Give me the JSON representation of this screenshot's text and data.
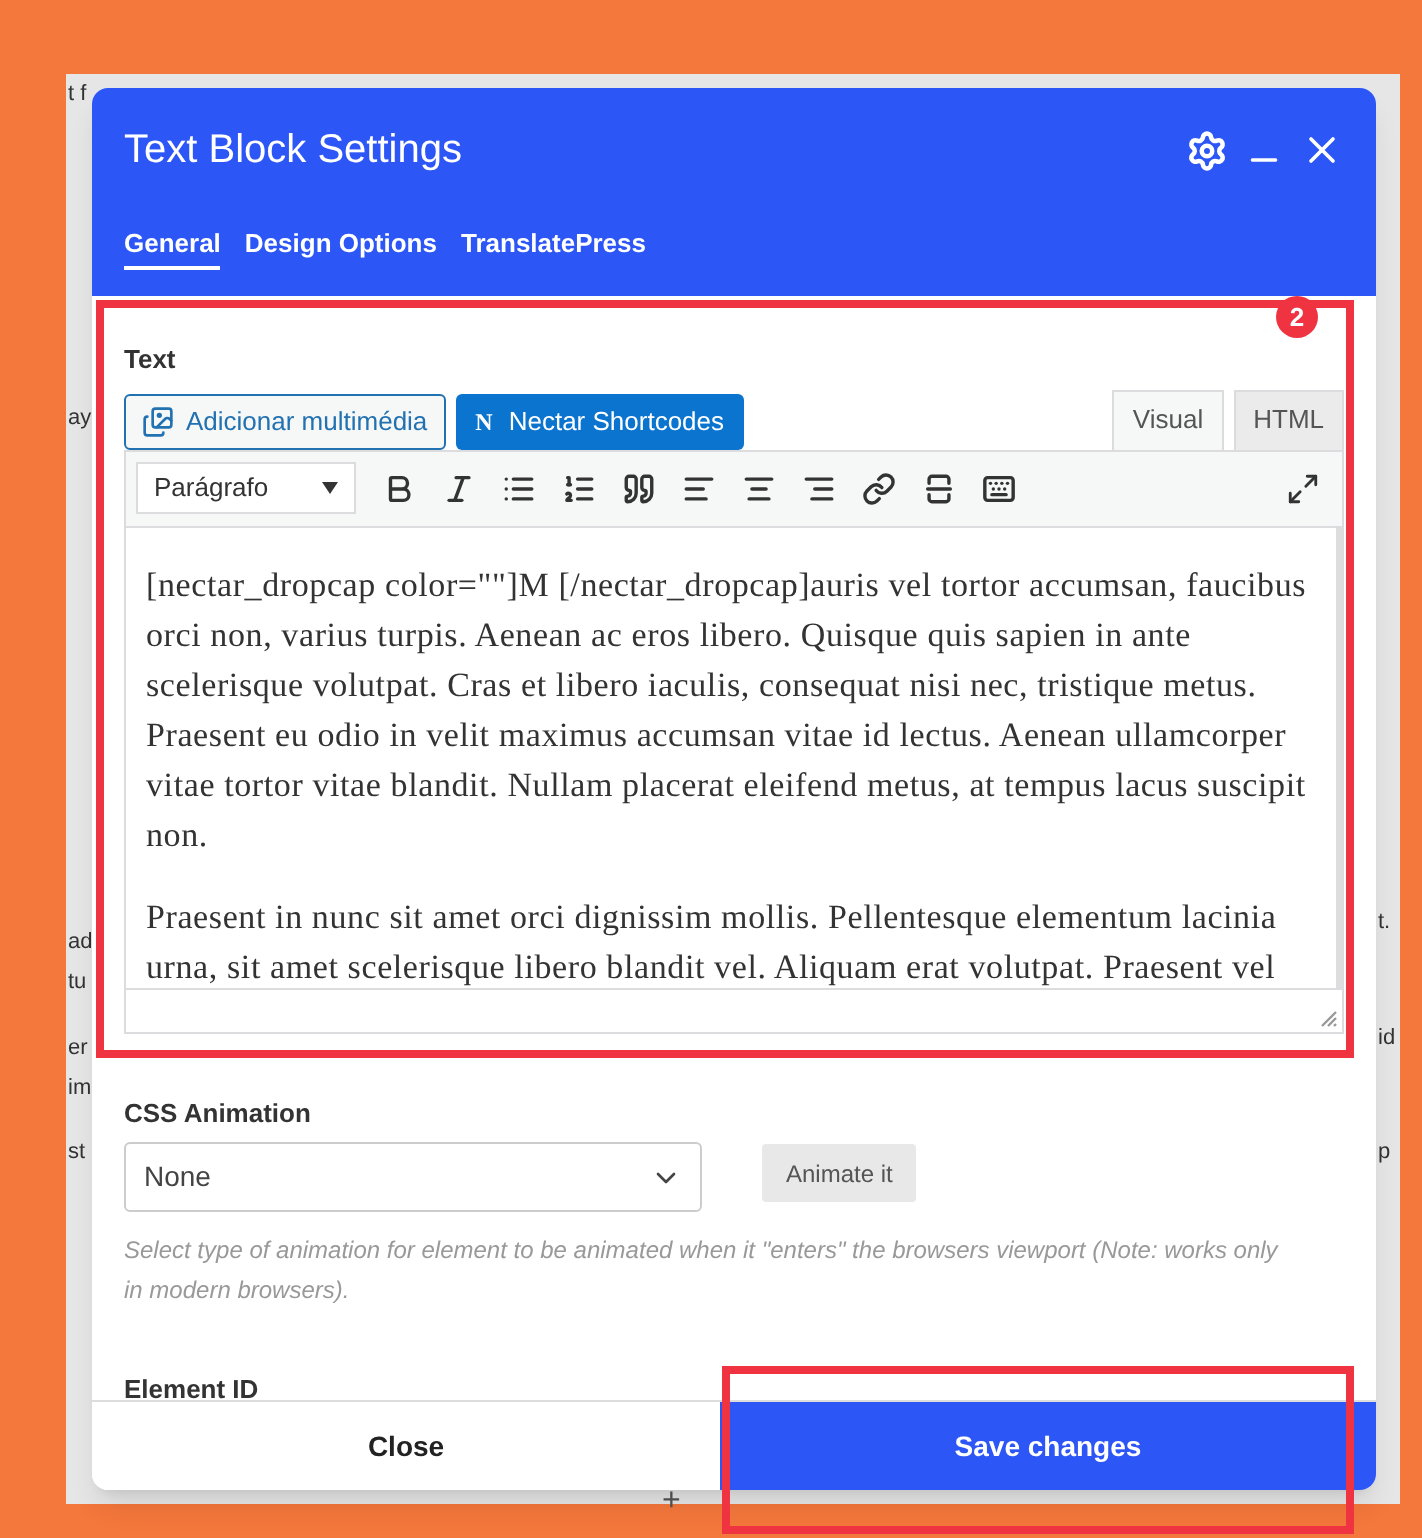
{
  "background_page": {
    "left_fragments": [
      "t f",
      "ay",
      "ad",
      "tu",
      "er",
      "im",
      "st"
    ],
    "right_fragments": [
      "t.",
      "id",
      "p"
    ],
    "add_symbol": "+"
  },
  "dialog": {
    "title": "Text Block Settings",
    "tabs": [
      {
        "label": "General",
        "selected": true
      },
      {
        "label": "Design Options",
        "selected": false
      },
      {
        "label": "TranslatePress",
        "selected": false
      }
    ]
  },
  "text_field": {
    "label": "Text",
    "annotation_badge": "2",
    "media_button": "Adicionar multimédia",
    "shortcodes_glyph": "N",
    "shortcodes_button": "Nectar Shortcodes",
    "editor_tabs": [
      {
        "label": "Visual",
        "selected": true
      },
      {
        "label": "HTML",
        "selected": false
      }
    ],
    "format_select": "Parágrafo",
    "paragraphs": [
      "[nectar_dropcap color=\"\"]M [/nectar_dropcap]auris vel tortor accumsan, faucibus orci non, varius turpis. Aenean ac eros libero. Quisque quis sapien in ante scelerisque volutpat. Cras et libero iaculis, consequat nisi nec, tristique metus. Praesent eu odio in velit maximus accumsan vitae id lectus. Aenean ullamcorper vitae tortor vitae blandit. Nullam placerat eleifend metus, at tempus lacus suscipit non.",
      "Praesent in nunc sit amet orci dignissim mollis. Pellentesque elementum lacinia urna, sit amet scelerisque libero blandit vel. Aliquam erat volutpat. Praesent vel"
    ]
  },
  "css_animation": {
    "label": "CSS Animation",
    "value": "None",
    "animate_button": "Animate it",
    "help": "Select type of animation for element to be animated when it \"enters\" the browsers viewport (Note: works only in modern browsers)."
  },
  "element_id": {
    "label": "Element ID"
  },
  "footer": {
    "close": "Close",
    "save": "Save changes",
    "save_highlighted": true
  }
}
